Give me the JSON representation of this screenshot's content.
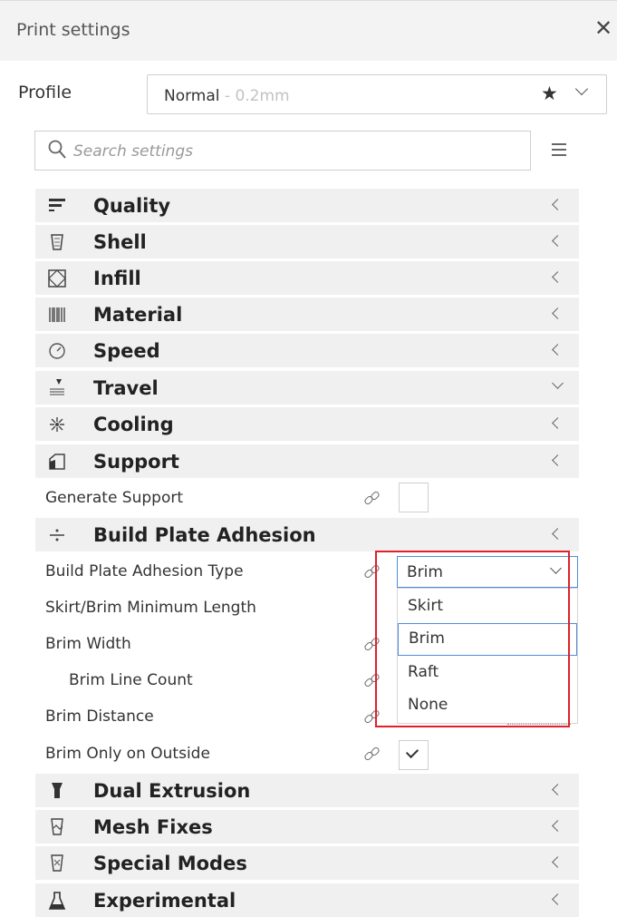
{
  "header": {
    "title": "Print settings",
    "close_glyph": "✕"
  },
  "profile": {
    "label": "Profile",
    "name": "Normal",
    "sub": " - 0.2mm",
    "star_glyph": "★"
  },
  "search": {
    "placeholder": "Search settings"
  },
  "categories_top": [
    {
      "label": "Quality",
      "icon": "quality-icon"
    },
    {
      "label": "Shell",
      "icon": "shell-icon"
    },
    {
      "label": "Infill",
      "icon": "infill-icon"
    },
    {
      "label": "Material",
      "icon": "material-icon"
    },
    {
      "label": "Speed",
      "icon": "speed-icon"
    },
    {
      "label": "Travel",
      "icon": "travel-icon",
      "expanded": true
    },
    {
      "label": "Cooling",
      "icon": "cooling-icon"
    },
    {
      "label": "Support",
      "icon": "support-icon"
    }
  ],
  "support_settings": {
    "generate_support": "Generate Support"
  },
  "adhesion": {
    "label": "Build Plate Adhesion",
    "settings": {
      "type": "Build Plate Adhesion Type",
      "skirt_min": "Skirt/Brim Minimum Length",
      "brim_width": "Brim Width",
      "brim_line_count": "Brim Line Count",
      "brim_distance": "Brim Distance",
      "brim_outside": "Brim Only on Outside"
    },
    "dropdown": {
      "value": "Brim",
      "options": [
        "Skirt",
        "Brim",
        "Raft",
        "None"
      ],
      "highlighted": "Brim"
    },
    "brim_outside_checked": true
  },
  "categories_bottom": [
    {
      "label": "Dual Extrusion",
      "icon": "dual-extrusion-icon"
    },
    {
      "label": "Mesh Fixes",
      "icon": "mesh-fixes-icon"
    },
    {
      "label": "Special Modes",
      "icon": "special-modes-icon"
    },
    {
      "label": "Experimental",
      "icon": "experimental-icon"
    }
  ],
  "colors": {
    "accent_blue": "#4e8fd8",
    "highlight_red": "#e0202b",
    "category_bg": "#f0f0f0"
  }
}
